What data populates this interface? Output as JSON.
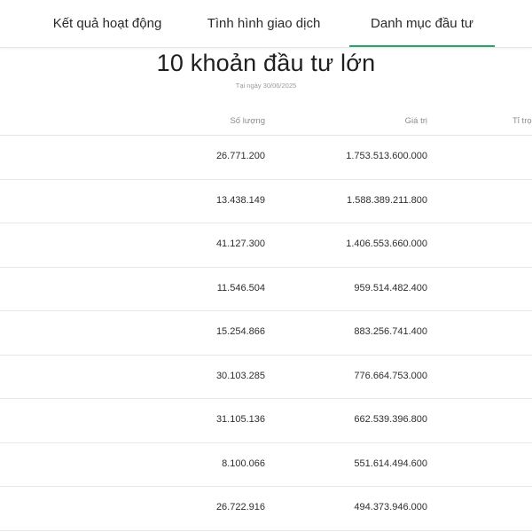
{
  "tabs": [
    {
      "label": "Kết quả hoạt động"
    },
    {
      "label": "Tình hình giao dịch"
    },
    {
      "label": "Danh mục đầu tư"
    }
  ],
  "active_tab": "Danh mục đầu tư",
  "accent_color": "#27a36b",
  "title": "10 khoản đầu tư lớn",
  "subtitle": "Tại ngày 30/06/2025",
  "table": {
    "headers": {
      "quantity": "Số lượng",
      "value": "Giá trị",
      "ratio": "Tỉ trọ"
    },
    "rows": [
      {
        "quantity": "26.771.200",
        "value": "1.753.513.600.000"
      },
      {
        "quantity": "13.438.149",
        "value": "1.588.389.211.800"
      },
      {
        "quantity": "41.127.300",
        "value": "1.406.553.660.000"
      },
      {
        "quantity": "11.546.504",
        "value": "959.514.482.400"
      },
      {
        "quantity": "15.254.866",
        "value": "883.256.741.400"
      },
      {
        "quantity": "30.103.285",
        "value": "776.664.753.000"
      },
      {
        "quantity": "31.105.136",
        "value": "662.539.396.800"
      },
      {
        "quantity": "8.100.066",
        "value": "551.614.494.600"
      },
      {
        "quantity": "26.722.916",
        "value": "494.373.946.000"
      }
    ]
  }
}
